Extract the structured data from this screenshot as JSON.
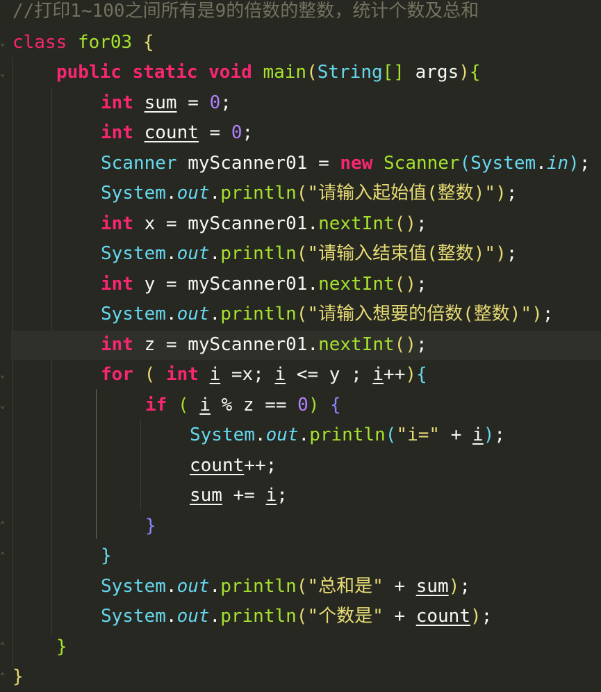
{
  "code": {
    "comment": "//打印1~100之间所有是9的倍数的整数，统计个数及总和",
    "class_kw": "class",
    "class_name": "for03",
    "public_kw": "public",
    "static_kw": "static",
    "void_kw": "void",
    "method_name": "main",
    "param_type": "String",
    "param_name": "args",
    "int_kw": "int",
    "new_kw": "new",
    "for_kw": "for",
    "if_kw": "if",
    "var_sum": "sum",
    "var_count": "count",
    "var_i": "i",
    "zero": "0",
    "scanner_type": "Scanner",
    "scanner_var": "myScanner01",
    "system": "System",
    "in_field": "in",
    "out_field": "out",
    "println": "println",
    "nextInt": "nextInt",
    "str_start": "\"请输入起始值(整数)\"",
    "str_end": "\"请输入结束值(整数)\"",
    "str_multiple": "\"请输入想要的倍数(整数)\"",
    "str_i": "\"i=\"",
    "str_total": "\"总和是\"",
    "str_cnt": "\"个数是\""
  },
  "colors": {
    "background": "#272822",
    "keyword": "#f92672",
    "function": "#a6e22e",
    "type": "#66d9ef",
    "string": "#e6db74",
    "number": "#ae81ff",
    "comment": "#75715e"
  }
}
